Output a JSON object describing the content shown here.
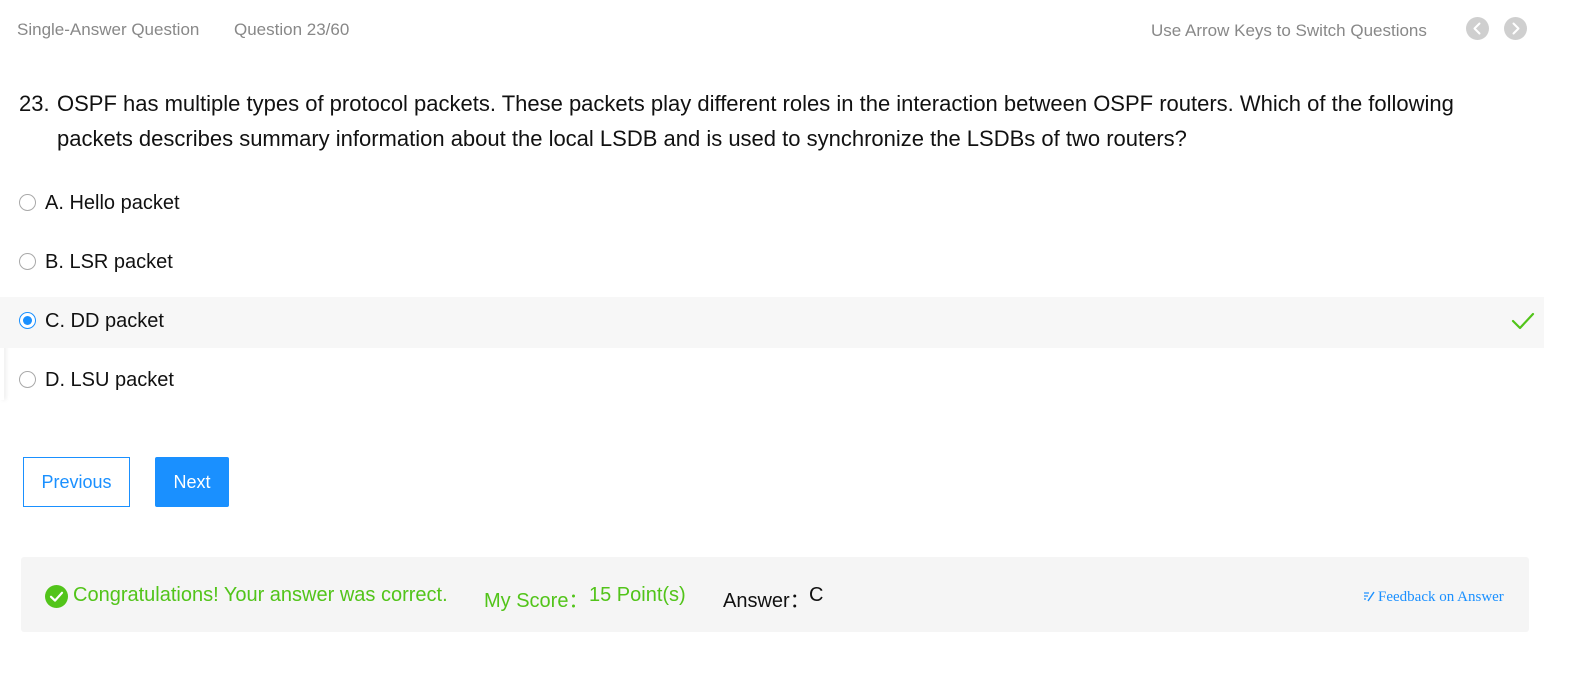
{
  "header": {
    "question_type": "Single-Answer Question",
    "question_counter": "Question 23/60",
    "hint": "Use Arrow Keys to Switch Questions",
    "prev_icon": "chevron-left-icon",
    "next_icon": "chevron-right-icon"
  },
  "question": {
    "number": "23.",
    "text": "OSPF has multiple types of protocol packets. These packets play different roles in the interaction between OSPF routers. Which of the following packets describes summary information about the local LSDB and is used to synchronize the LSDBs of two routers?"
  },
  "options": [
    {
      "label": "A. Hello packet",
      "selected": false
    },
    {
      "label": "B. LSR packet",
      "selected": false
    },
    {
      "label": "C. DD packet",
      "selected": true,
      "correct": true
    },
    {
      "label": "D. LSU packet",
      "selected": false
    }
  ],
  "buttons": {
    "previous": "Previous",
    "next": "Next"
  },
  "result": {
    "message": "Congratulations! Your answer was correct.",
    "score_label": "My Score：",
    "score_value": "15 Point(s)",
    "answer_label": "Answer：",
    "answer_value": "C",
    "feedback_link": "Feedback on Answer"
  },
  "colors": {
    "accent": "#1a90ff",
    "success": "#52c41a",
    "muted": "#888888"
  }
}
